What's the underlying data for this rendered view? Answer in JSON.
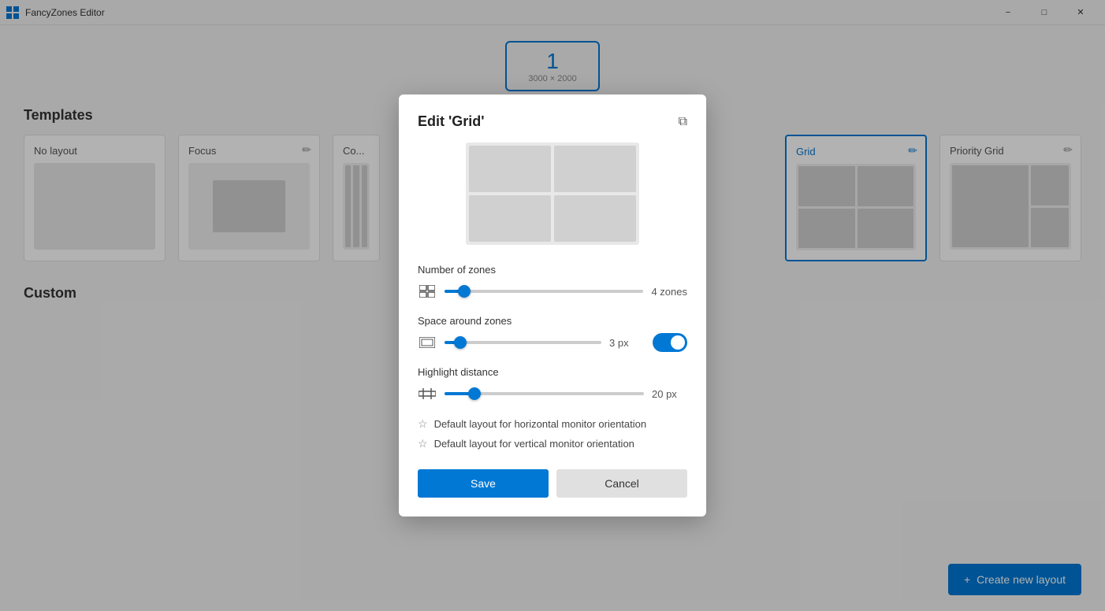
{
  "titlebar": {
    "title": "FancyZones Editor",
    "icon": "⊞",
    "minimize_label": "−",
    "maximize_label": "□",
    "close_label": "✕"
  },
  "monitor": {
    "number": "1",
    "resolution": "3000 × 2000"
  },
  "templates_section": {
    "title": "Templates",
    "cards": [
      {
        "id": "no-layout",
        "title": "No layout",
        "type": "empty"
      },
      {
        "id": "focus",
        "title": "Focus",
        "type": "focus"
      },
      {
        "id": "columns",
        "title": "Co...",
        "type": "columns"
      },
      {
        "id": "grid",
        "title": "Grid",
        "type": "grid",
        "selected": true
      },
      {
        "id": "priority-grid",
        "title": "Priority Grid",
        "type": "priority"
      }
    ]
  },
  "custom_section": {
    "title": "Custom"
  },
  "create_button": {
    "label": "Create new layout",
    "plus": "+"
  },
  "dialog": {
    "title": "Edit 'Grid'",
    "copy_icon": "⧉",
    "zones_label": "Number of zones",
    "zones_value": "4 zones",
    "zones_percent": 10,
    "space_label": "Space around zones",
    "space_value": "3 px",
    "space_percent": 10,
    "space_toggle": true,
    "highlight_label": "Highlight distance",
    "highlight_value": "20 px",
    "highlight_percent": 15,
    "default_horizontal": "Default layout for horizontal monitor orientation",
    "default_vertical": "Default layout for vertical monitor orientation",
    "save_label": "Save",
    "cancel_label": "Cancel"
  }
}
